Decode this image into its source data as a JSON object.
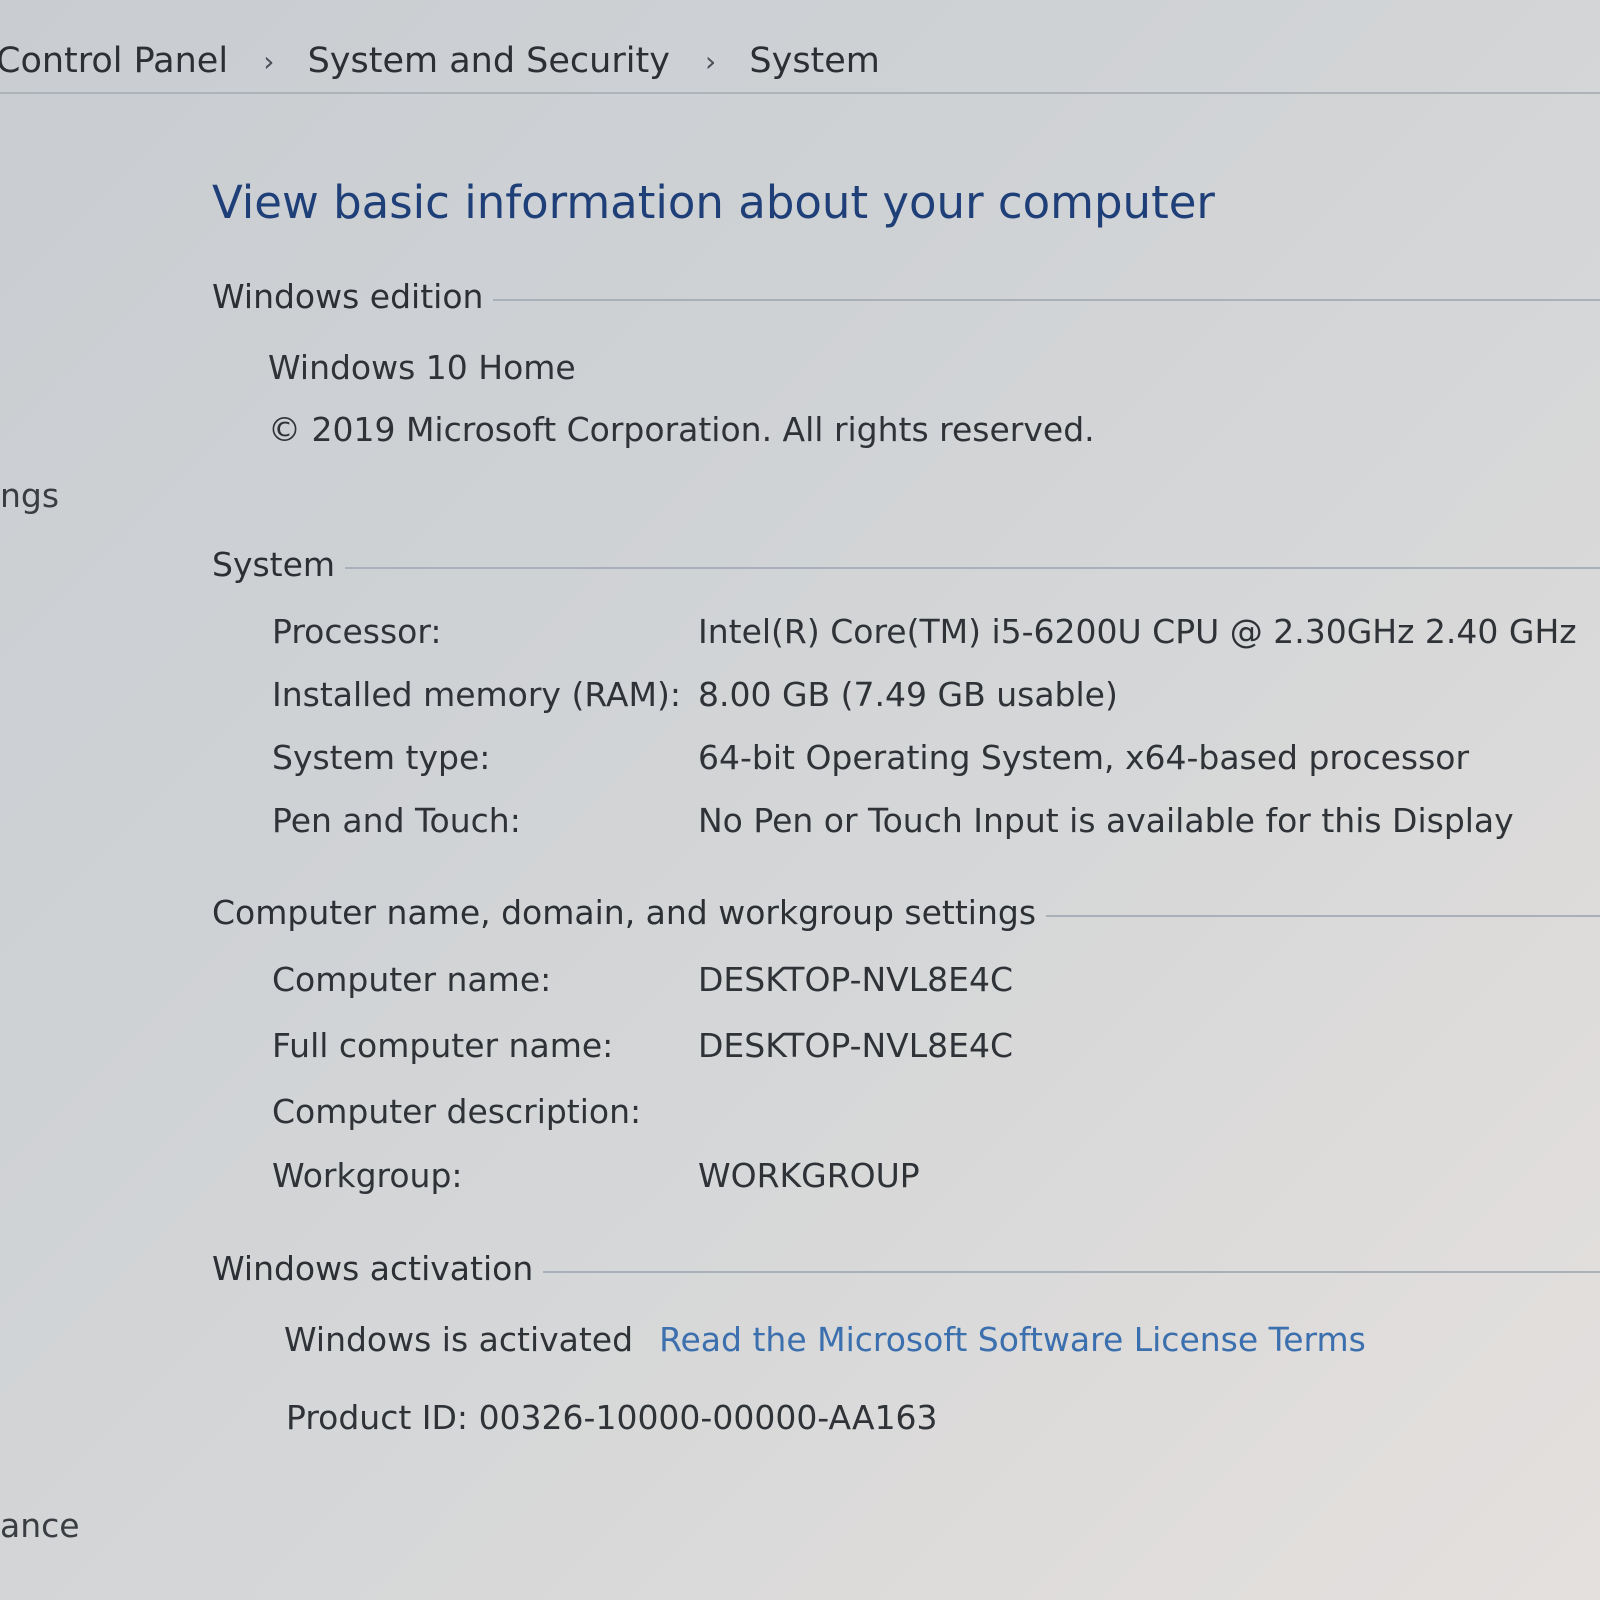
{
  "breadcrumb": {
    "items": [
      "Control Panel",
      "System and Security",
      "System"
    ],
    "separator": "›"
  },
  "left_panel": {
    "fragment_1": "ngs",
    "fragment_2": "ance"
  },
  "page_title": "View basic information about your computer",
  "windows_edition": {
    "header": "Windows edition",
    "edition": "Windows 10 Home",
    "copyright": "© 2019 Microsoft Corporation. All rights reserved."
  },
  "system": {
    "header": "System",
    "rows": [
      {
        "label": "Processor:",
        "value": "Intel(R) Core(TM) i5-6200U CPU @ 2.30GHz   2.40 GHz"
      },
      {
        "label": "Installed memory (RAM):",
        "value": "8.00 GB (7.49 GB usable)"
      },
      {
        "label": "System type:",
        "value": "64-bit Operating System, x64-based processor"
      },
      {
        "label": "Pen and Touch:",
        "value": "No Pen or Touch Input is available for this Display"
      }
    ]
  },
  "computer_name": {
    "header": "Computer name, domain, and workgroup settings",
    "rows": [
      {
        "label": "Computer name:",
        "value": "DESKTOP-NVL8E4C"
      },
      {
        "label": "Full computer name:",
        "value": "DESKTOP-NVL8E4C"
      },
      {
        "label": "Computer description:",
        "value": ""
      },
      {
        "label": "Workgroup:",
        "value": "WORKGROUP"
      }
    ]
  },
  "activation": {
    "header": "Windows activation",
    "status": "Windows is activated",
    "license_link": "Read the Microsoft Software License Terms",
    "product_id_label": "Product ID:",
    "product_id": "00326-10000-00000-AA163"
  },
  "colors": {
    "title": "#1e3f78",
    "link": "#3b6fae",
    "text": "#2f3338"
  }
}
